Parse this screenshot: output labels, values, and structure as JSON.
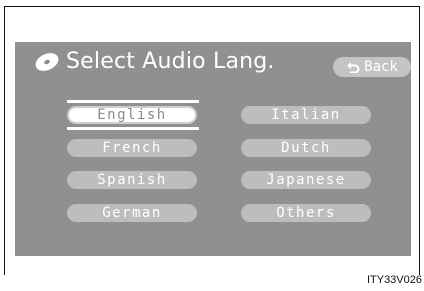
{
  "header": {
    "title": "Select Audio Lang.",
    "back_label": "Back"
  },
  "languages": [
    {
      "label": "English",
      "selected": true
    },
    {
      "label": "Italian",
      "selected": false
    },
    {
      "label": "French",
      "selected": false
    },
    {
      "label": "Dutch",
      "selected": false
    },
    {
      "label": "Spanish",
      "selected": false
    },
    {
      "label": "Japanese",
      "selected": false
    },
    {
      "label": "German",
      "selected": false
    },
    {
      "label": "Others",
      "selected": false
    }
  ],
  "caption": "ITY33V026",
  "icons": {
    "title": "disc-icon",
    "back": "return-arrow-icon"
  },
  "colors": {
    "screen": "#909090",
    "button": "#bdbdbd",
    "selected_button": "#ffffff",
    "text": "#ffffff"
  }
}
